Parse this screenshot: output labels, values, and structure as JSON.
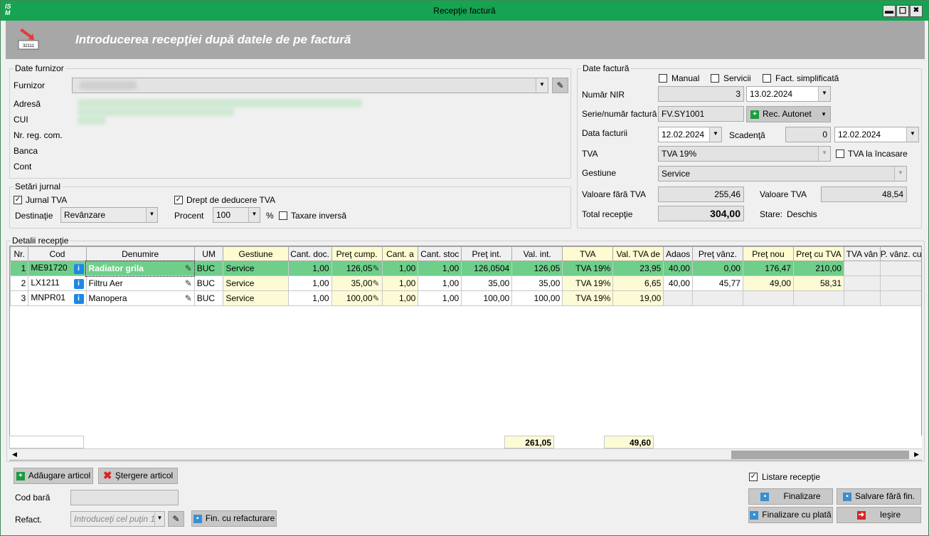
{
  "window": {
    "title": "Recepţie factură",
    "min": "▬",
    "max": "☐",
    "close": "✖"
  },
  "banner": {
    "title": "Introducerea recepţiei după datele de pe factură",
    "icon_label": "32111"
  },
  "supplier": {
    "legend": "Date furnizor",
    "furnizor_label": "Furnizor",
    "adresa_label": "Adresă",
    "cui_label": "CUI",
    "nrreg_label": "Nr. reg. com.",
    "banca_label": "Banca",
    "cont_label": "Cont"
  },
  "journal": {
    "legend": "Setări jurnal",
    "jurnal_tva": "Jurnal TVA",
    "drept": "Drept de deducere TVA",
    "destinatie_label": "Destinaţie",
    "destinatie": "Revânzare",
    "procent_label": "Procent",
    "procent": "100",
    "pct": "%",
    "taxare": "Taxare inversă"
  },
  "invoice": {
    "legend": "Date factură",
    "manual": "Manual",
    "servicii": "Servicii",
    "fact_simpl": "Fact. simplificată",
    "nir_label": "Număr NIR",
    "nir": "3",
    "nir_date": "13.02.2024",
    "serie_label": "Serie/număr factură",
    "serie": "FV.SY1001",
    "rec_autonet": "Rec. Autonet",
    "data_label": "Data facturii",
    "data": "12.02.2024",
    "scadenta_label": "Scadenţă",
    "scadenta_days": "0",
    "scadenta_date": "12.02.2024",
    "tva_label": "TVA",
    "tva": "TVA 19%",
    "tva_incasare": "TVA la încasare",
    "gestiune_label": "Gestiune",
    "gestiune": "Service",
    "val_fara_label": "Valoare fără TVA",
    "val_fara": "255,46",
    "val_tva_label": "Valoare TVA",
    "val_tva": "48,54",
    "total_label": "Total recepţie",
    "total": "304,00",
    "stare_label": "Stare:",
    "stare": "Deschis"
  },
  "details": {
    "legend": "Detalii recepţie",
    "columns": [
      "Nr.",
      "Cod",
      "Denumire",
      "UM",
      "Gestiune",
      "Cant. doc.",
      "Preţ cump.",
      "Cant. a",
      "Cant. stoc",
      "Preţ int.",
      "Val. int.",
      "TVA",
      "Val. TVA de",
      "Adaos",
      "Preţ vânz.",
      "Preţ nou",
      "Preţ cu TVA",
      "TVA vân",
      "P. vânz. cu TV"
    ],
    "rows": [
      [
        "1",
        "ME91720",
        "Radiator grila",
        "BUC",
        "Service",
        "1,00",
        "126,05",
        "1,00",
        "1,00",
        "126,0504",
        "126,05",
        "TVA 19%",
        "23,95",
        "40,00",
        "0,00",
        "176,47",
        "210,00",
        "",
        ""
      ],
      [
        "2",
        "LX1211",
        "Filtru Aer",
        "BUC",
        "Service",
        "1,00",
        "35,00",
        "1,00",
        "1,00",
        "35,00",
        "35,00",
        "TVA 19%",
        "6,65",
        "40,00",
        "45,77",
        "49,00",
        "58,31",
        "",
        ""
      ],
      [
        "3",
        "MNPR01",
        "Manopera",
        "BUC",
        "Service",
        "1,00",
        "100,00",
        "1,00",
        "1,00",
        "100,00",
        "100,00",
        "TVA 19%",
        "19,00",
        "",
        "",
        "",
        "",
        "",
        ""
      ]
    ],
    "total_val_int": "261,05",
    "total_val_tva": "49,60"
  },
  "bottom": {
    "add": "Adăugare articol",
    "del": "Ştergere articol",
    "cod_bara_label": "Cod bară",
    "refact_label": "Refact.",
    "refact_placeholder": "Introduceţi cel puţin 1",
    "fin_refact": "Fin. cu refacturare",
    "listare": "Listare recepţie",
    "finalizare": "Finalizare",
    "salvare": "Salvare fără fin.",
    "fin_plata": "Finalizare cu plată",
    "iesire": "Ieşire"
  }
}
